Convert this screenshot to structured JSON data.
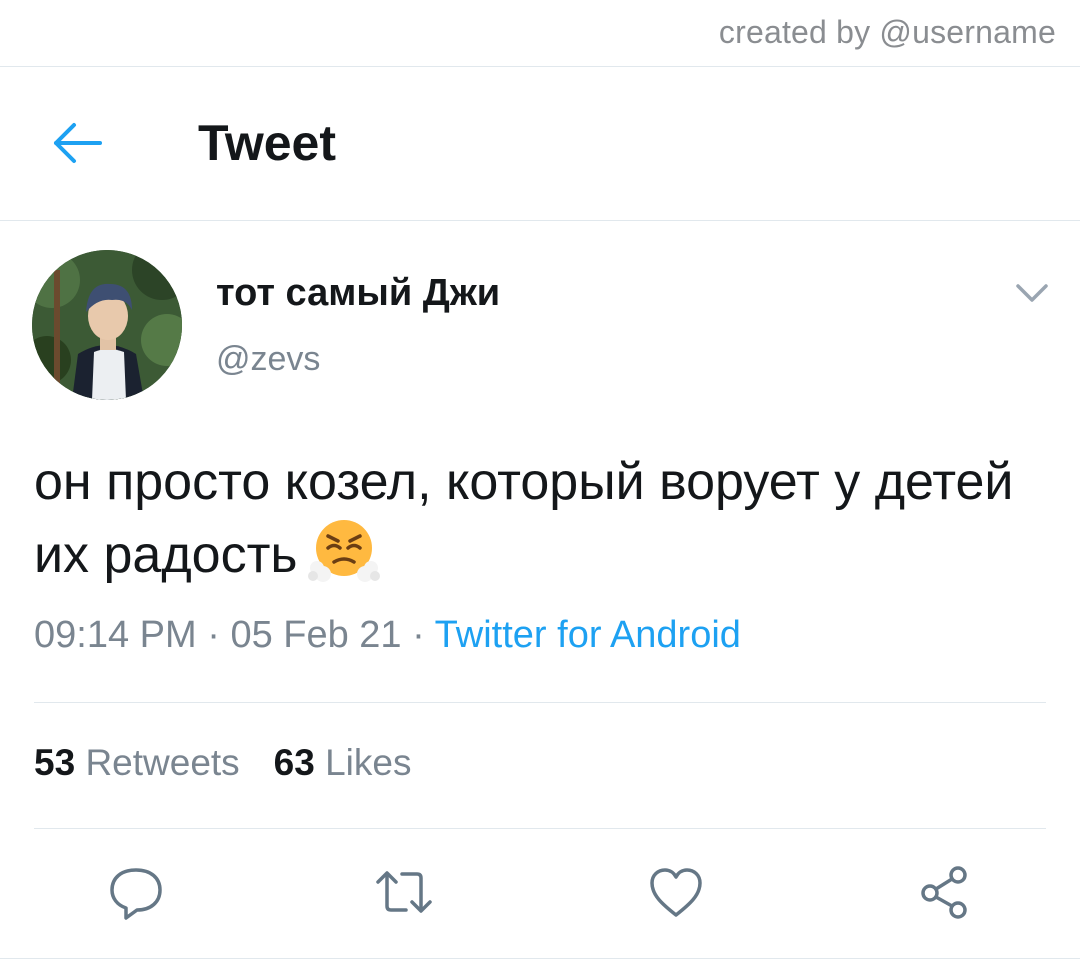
{
  "credit": "created by @username",
  "header": {
    "title": "Tweet",
    "back_icon": "arrow-left-icon"
  },
  "tweet": {
    "display_name": "тот самый Джи",
    "handle": "@zevs",
    "text": "он просто козел, который ворует у детей их радость",
    "emoji": "face-with-steam-from-nose",
    "time": "09:14 PM",
    "separator": "·",
    "date": "05 Feb 21",
    "source": "Twitter for Android"
  },
  "stats": {
    "retweets_count": "53",
    "retweets_label": "Retweets",
    "likes_count": "63",
    "likes_label": "Likes"
  },
  "actions": [
    {
      "icon": "reply-icon"
    },
    {
      "icon": "retweet-icon"
    },
    {
      "icon": "like-icon"
    },
    {
      "icon": "share-icon"
    }
  ],
  "colors": {
    "accent": "#1da1f2",
    "text_primary": "#14171a",
    "text_secondary": "#7a8590",
    "divider": "#e1e8ed",
    "icon_gray": "#657786"
  }
}
